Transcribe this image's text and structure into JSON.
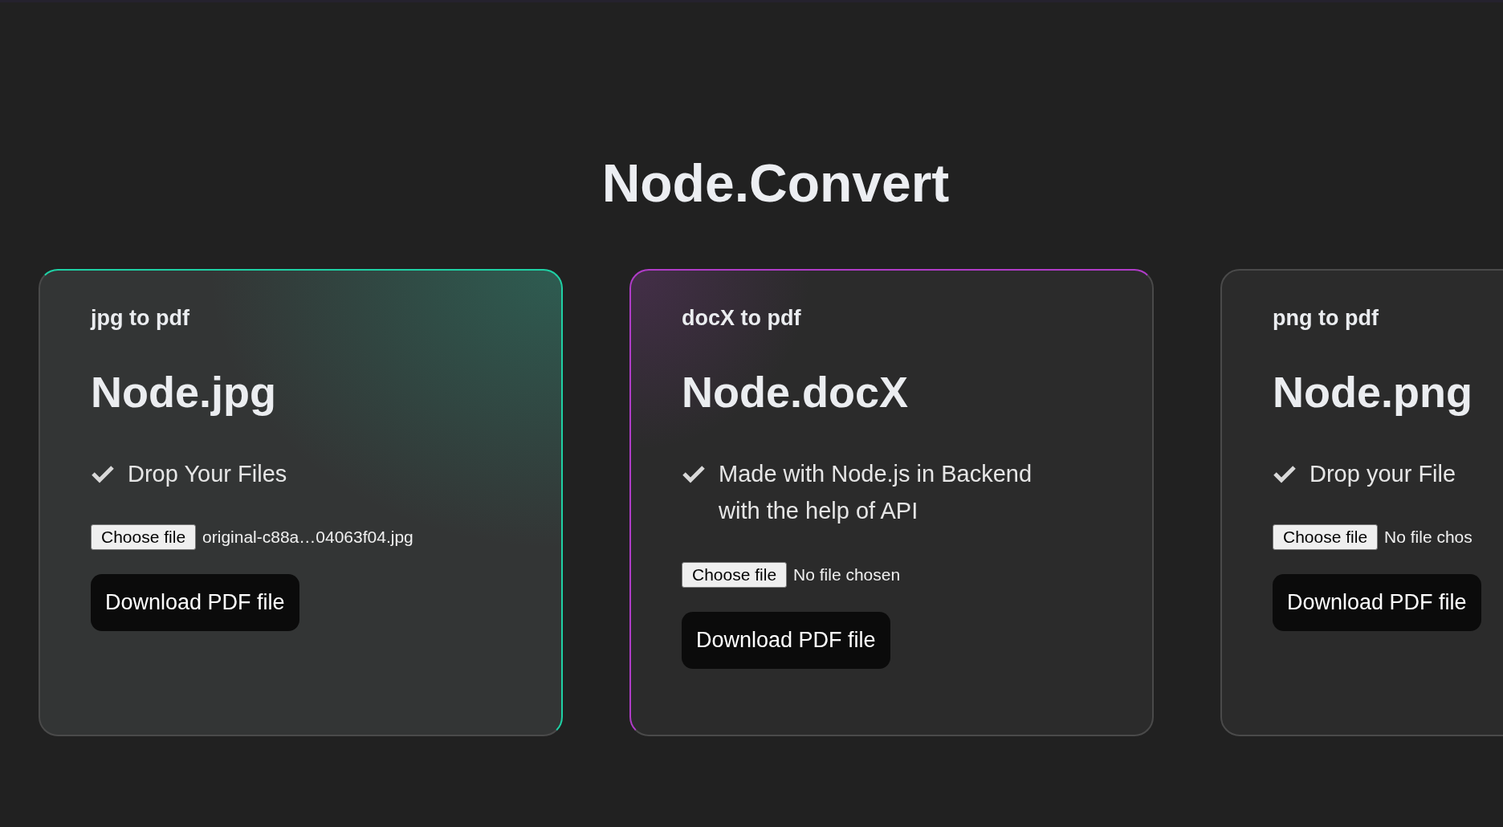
{
  "title": "Node.Convert",
  "cards": [
    {
      "caption": "jpg to pdf",
      "heading": "Node.jpg",
      "feature": "Drop Your Files",
      "file_button": "Choose file",
      "file_status": "original-c88a…04063f04.jpg",
      "action": "Download PDF file",
      "highlighted": true,
      "color": "#1fd1a5"
    },
    {
      "caption": "docX to pdf",
      "heading": "Node.docX",
      "feature": "Made with Node.js in Backend with the help of API",
      "file_button": "Choose file",
      "file_status": "No file chosen",
      "action": "Download PDF file",
      "highlighted": false,
      "color": "#b03cc8"
    },
    {
      "caption": "png to pdf",
      "heading": "Node.png",
      "feature": "Drop your File",
      "file_button": "Choose file",
      "file_status": "No file chos",
      "action": "Download PDF file",
      "highlighted": false
    }
  ]
}
